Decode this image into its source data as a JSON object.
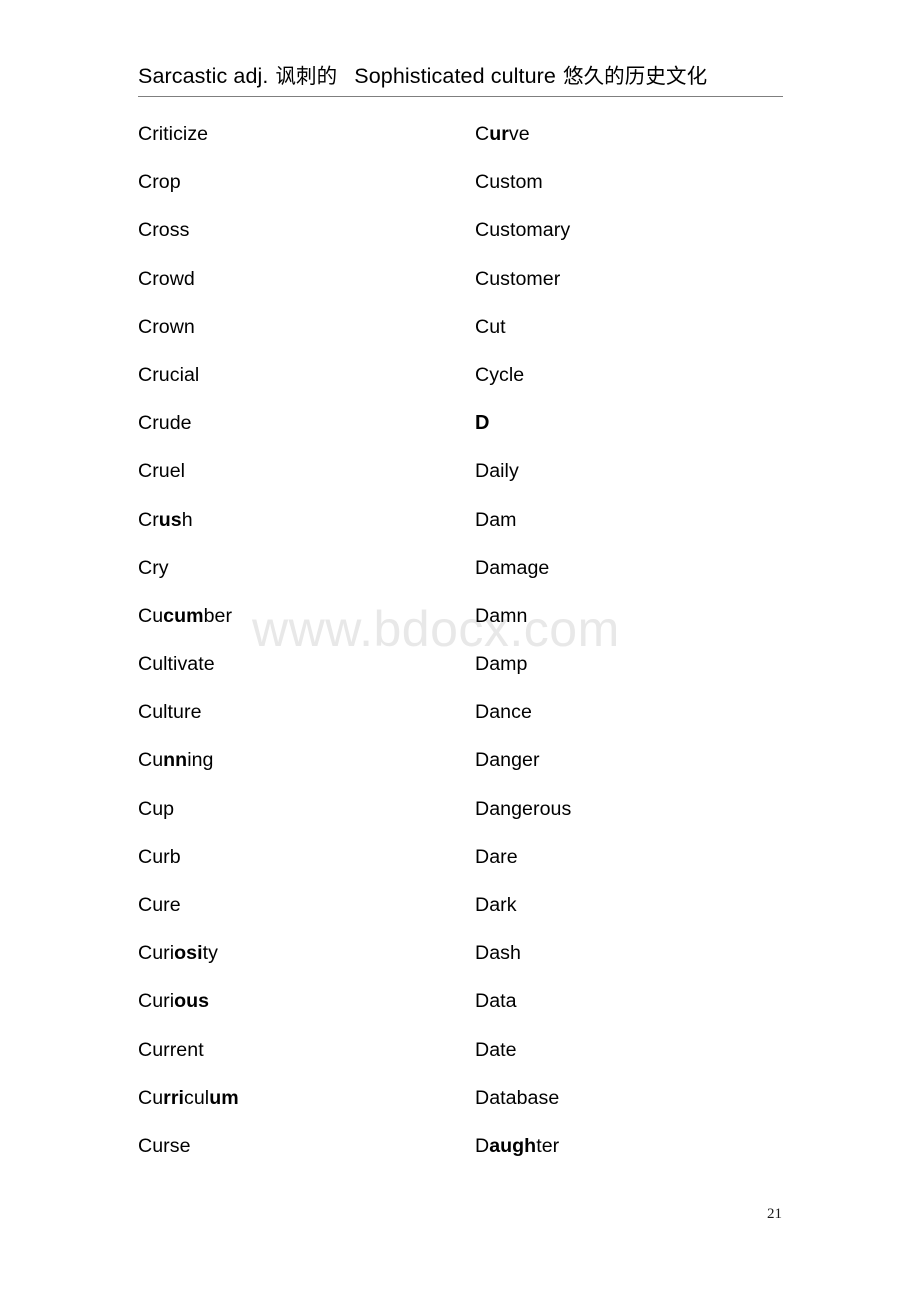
{
  "document": {
    "header": {
      "left_en": "Sarcastic adj.",
      "left_zh": "讽刺的",
      "right_en": "Sophisticated culture",
      "right_zh": "悠久的历史文化"
    },
    "watermark": "www.bdocx.com",
    "page_number": "21",
    "columns": {
      "left": [
        {
          "text": "Criticize",
          "plain": "Criticize",
          "bold": ""
        },
        {
          "text": "Crop",
          "plain": "Crop",
          "bold": ""
        },
        {
          "text": "Cross",
          "plain": "Cross",
          "bold": ""
        },
        {
          "text": "Crowd",
          "plain": "Crowd",
          "bold": ""
        },
        {
          "text": "Crown",
          "plain": "Crown",
          "bold": ""
        },
        {
          "text": "Crucial",
          "plain": "Crucial",
          "bold": ""
        },
        {
          "text": "Crude",
          "plain": "Crude",
          "bold": ""
        },
        {
          "text": "Cruel",
          "plain": "Cruel",
          "bold": ""
        },
        {
          "text": "Crush",
          "pre": "Cr",
          "bold": "us",
          "post": "h"
        },
        {
          "text": "Cry",
          "plain": "Cry",
          "bold": ""
        },
        {
          "text": "Cucumber",
          "pre": "Cu",
          "bold": "cum",
          "post": "ber"
        },
        {
          "text": "Cultivate",
          "plain": "Cultivate",
          "bold": ""
        },
        {
          "text": "Culture",
          "plain": "Culture",
          "bold": ""
        },
        {
          "text": "Cunning",
          "pre": "Cu",
          "bold": "nn",
          "post": "ing"
        },
        {
          "text": "Cup",
          "plain": "Cup",
          "bold": ""
        },
        {
          "text": "Curb",
          "plain": "Curb",
          "bold": ""
        },
        {
          "text": "Cure",
          "plain": "Cure",
          "bold": ""
        },
        {
          "text": "Curiosity",
          "pre": "Curi",
          "bold": "osi",
          "post": "ty"
        },
        {
          "text": "Curious",
          "pre": "Curi",
          "bold": "ous",
          "post": ""
        },
        {
          "text": "Current",
          "plain": "Current",
          "bold": ""
        },
        {
          "text": "Curriculum",
          "pre": "Cu",
          "bold": "rri",
          "post": "cul",
          "bold2": "um"
        },
        {
          "text": "Curse",
          "plain": "Curse",
          "bold": ""
        }
      ],
      "right": [
        {
          "text": "Curve",
          "pre": "C",
          "bold": "ur",
          "post": "ve"
        },
        {
          "text": "Custom",
          "plain": "Custom",
          "bold": ""
        },
        {
          "text": "Customary",
          "plain": "Customary",
          "bold": ""
        },
        {
          "text": "Customer",
          "plain": "Customer",
          "bold": ""
        },
        {
          "text": "Cut",
          "plain": "Cut",
          "bold": ""
        },
        {
          "text": "Cycle",
          "plain": "Cycle",
          "bold": ""
        },
        {
          "text": "D",
          "plain": "D",
          "bold": "",
          "is_section": true
        },
        {
          "text": "Daily",
          "plain": "Daily",
          "bold": ""
        },
        {
          "text": "Dam",
          "plain": "Dam",
          "bold": ""
        },
        {
          "text": "Damage",
          "plain": "Damage",
          "bold": ""
        },
        {
          "text": "Damn",
          "plain": "Damn",
          "bold": ""
        },
        {
          "text": "Damp",
          "plain": "Damp",
          "bold": ""
        },
        {
          "text": "Dance",
          "plain": "Dance",
          "bold": ""
        },
        {
          "text": "Danger",
          "plain": "Danger",
          "bold": ""
        },
        {
          "text": "Dangerous",
          "plain": "Dangerous",
          "bold": ""
        },
        {
          "text": "Dare",
          "plain": "Dare",
          "bold": ""
        },
        {
          "text": "Dark",
          "plain": "Dark",
          "bold": ""
        },
        {
          "text": "Dash",
          "plain": "Dash",
          "bold": ""
        },
        {
          "text": "Data",
          "plain": "Data",
          "bold": ""
        },
        {
          "text": "Date",
          "plain": "Date",
          "bold": ""
        },
        {
          "text": "Database",
          "plain": "Database",
          "bold": ""
        },
        {
          "text": "Daughter",
          "pre": "D",
          "bold": "augh",
          "post": "ter"
        }
      ]
    }
  }
}
